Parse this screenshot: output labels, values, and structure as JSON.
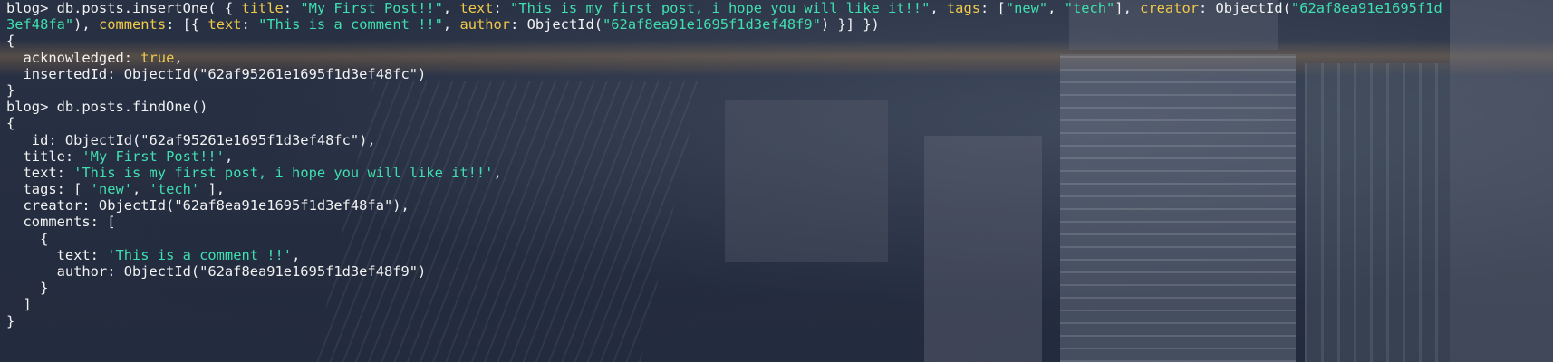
{
  "terminal": {
    "lines": [
      {
        "segments": [
          {
            "text": "blog> db.posts.insertOne( { ",
            "role": "plain"
          },
          {
            "text": "title",
            "role": "key"
          },
          {
            "text": ": ",
            "role": "plain"
          },
          {
            "text": "\"My First Post!!\"",
            "role": "string"
          },
          {
            "text": ", ",
            "role": "plain"
          },
          {
            "text": "text",
            "role": "key"
          },
          {
            "text": ": ",
            "role": "plain"
          },
          {
            "text": "\"This is my first post, i hope you will like it!!\"",
            "role": "string"
          },
          {
            "text": ", ",
            "role": "plain"
          },
          {
            "text": "tags",
            "role": "key"
          },
          {
            "text": ": [",
            "role": "plain"
          },
          {
            "text": "\"new\"",
            "role": "string"
          },
          {
            "text": ", ",
            "role": "plain"
          },
          {
            "text": "\"tech\"",
            "role": "string"
          },
          {
            "text": "], ",
            "role": "plain"
          },
          {
            "text": "creator",
            "role": "key"
          },
          {
            "text": ": ObjectId(",
            "role": "plain"
          },
          {
            "text": "\"62af8ea91e1695f1d",
            "role": "string"
          }
        ]
      },
      {
        "segments": [
          {
            "text": "3ef48fa\"",
            "role": "string"
          },
          {
            "text": "), ",
            "role": "plain"
          },
          {
            "text": "comments",
            "role": "key"
          },
          {
            "text": ": [{ ",
            "role": "plain"
          },
          {
            "text": "text",
            "role": "key"
          },
          {
            "text": ": ",
            "role": "plain"
          },
          {
            "text": "\"This is a comment !!\"",
            "role": "string"
          },
          {
            "text": ", ",
            "role": "plain"
          },
          {
            "text": "author",
            "role": "key"
          },
          {
            "text": ": ObjectId(",
            "role": "plain"
          },
          {
            "text": "\"62af8ea91e1695f1d3ef48f9\"",
            "role": "string"
          },
          {
            "text": ") }] })",
            "role": "plain"
          }
        ]
      },
      {
        "segments": [
          {
            "text": "{",
            "role": "plain"
          }
        ]
      },
      {
        "segments": [
          {
            "text": "  acknowledged: ",
            "role": "plain"
          },
          {
            "text": "true",
            "role": "bool"
          },
          {
            "text": ",",
            "role": "plain"
          }
        ]
      },
      {
        "segments": [
          {
            "text": "  insertedId: ObjectId(\"62af95261e1695f1d3ef48fc\")",
            "role": "plain"
          }
        ]
      },
      {
        "segments": [
          {
            "text": "}",
            "role": "plain"
          }
        ]
      },
      {
        "segments": [
          {
            "text": "blog> db.posts.findOne()",
            "role": "plain"
          }
        ]
      },
      {
        "segments": [
          {
            "text": "{",
            "role": "plain"
          }
        ]
      },
      {
        "segments": [
          {
            "text": "  _id: ObjectId(\"62af95261e1695f1d3ef48fc\"),",
            "role": "plain"
          }
        ]
      },
      {
        "segments": [
          {
            "text": "  title: ",
            "role": "plain"
          },
          {
            "text": "'My First Post!!'",
            "role": "string"
          },
          {
            "text": ",",
            "role": "plain"
          }
        ]
      },
      {
        "segments": [
          {
            "text": "  text: ",
            "role": "plain"
          },
          {
            "text": "'This is my first post, i hope you will like it!!'",
            "role": "string"
          },
          {
            "text": ",",
            "role": "plain"
          }
        ]
      },
      {
        "segments": [
          {
            "text": "  tags: [ ",
            "role": "plain"
          },
          {
            "text": "'new'",
            "role": "string"
          },
          {
            "text": ", ",
            "role": "plain"
          },
          {
            "text": "'tech'",
            "role": "string"
          },
          {
            "text": " ],",
            "role": "plain"
          }
        ]
      },
      {
        "segments": [
          {
            "text": "  creator: ObjectId(\"62af8ea91e1695f1d3ef48fa\"),",
            "role": "plain"
          }
        ]
      },
      {
        "segments": [
          {
            "text": "  comments: [",
            "role": "plain"
          }
        ]
      },
      {
        "segments": [
          {
            "text": "    {",
            "role": "plain"
          }
        ]
      },
      {
        "segments": [
          {
            "text": "      text: ",
            "role": "plain"
          },
          {
            "text": "'This is a comment !!'",
            "role": "string"
          },
          {
            "text": ",",
            "role": "plain"
          }
        ]
      },
      {
        "segments": [
          {
            "text": "      author: ObjectId(\"62af8ea91e1695f1d3ef48f9\")",
            "role": "plain"
          }
        ]
      },
      {
        "segments": [
          {
            "text": "    }",
            "role": "plain"
          }
        ]
      },
      {
        "segments": [
          {
            "text": "  ]",
            "role": "plain"
          }
        ]
      },
      {
        "segments": [
          {
            "text": "}",
            "role": "plain"
          }
        ]
      }
    ]
  },
  "colors": {
    "key": "#f0c94a",
    "string": "#3fdfb0",
    "bool": "#f0c94a",
    "plain": "#f2f2f2",
    "background": "#2b3447"
  }
}
